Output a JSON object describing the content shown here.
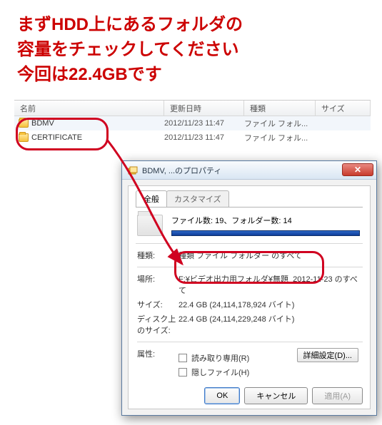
{
  "caption": {
    "line1": "まずHDD上にあるフォルダの",
    "line2": "容量をチェックしてください",
    "line3": "今回は22.4GBです"
  },
  "columns": {
    "name": "名前",
    "date": "更新日時",
    "type": "種類",
    "size": "サイズ"
  },
  "rows": [
    {
      "name": "BDMV",
      "date": "2012/11/23 11:47",
      "type": "ファイル フォル..."
    },
    {
      "name": "CERTIFICATE",
      "date": "2012/11/23 11:47",
      "type": "ファイル フォル..."
    }
  ],
  "dialog": {
    "title": "BDMV, ...のプロパティ",
    "tabs": {
      "general": "全般",
      "customize": "カスタマイズ"
    },
    "summary": "ファイル数: 19、フォルダー数: 14",
    "labels": {
      "kind": "種類:",
      "location": "場所:",
      "size": "サイズ:",
      "sizeOnDisk": "ディスク上\nのサイズ:",
      "attributes": "属性:"
    },
    "values": {
      "kind": "種類 ファイル フォルダー のすべて",
      "location": "F:¥ビデオ出力用フォルダ¥無題_2012-11-23 のすべて",
      "size": "22.4 GB (24,114,178,924 バイト)",
      "sizeOnDisk": "22.4 GB (24,114,229,248 バイト)"
    },
    "checks": {
      "readonly": "読み取り専用(R)",
      "hidden": "隠しファイル(H)"
    },
    "advanced": "詳細設定(D)...",
    "ok": "OK",
    "cancel": "キャンセル",
    "apply": "適用(A)"
  }
}
